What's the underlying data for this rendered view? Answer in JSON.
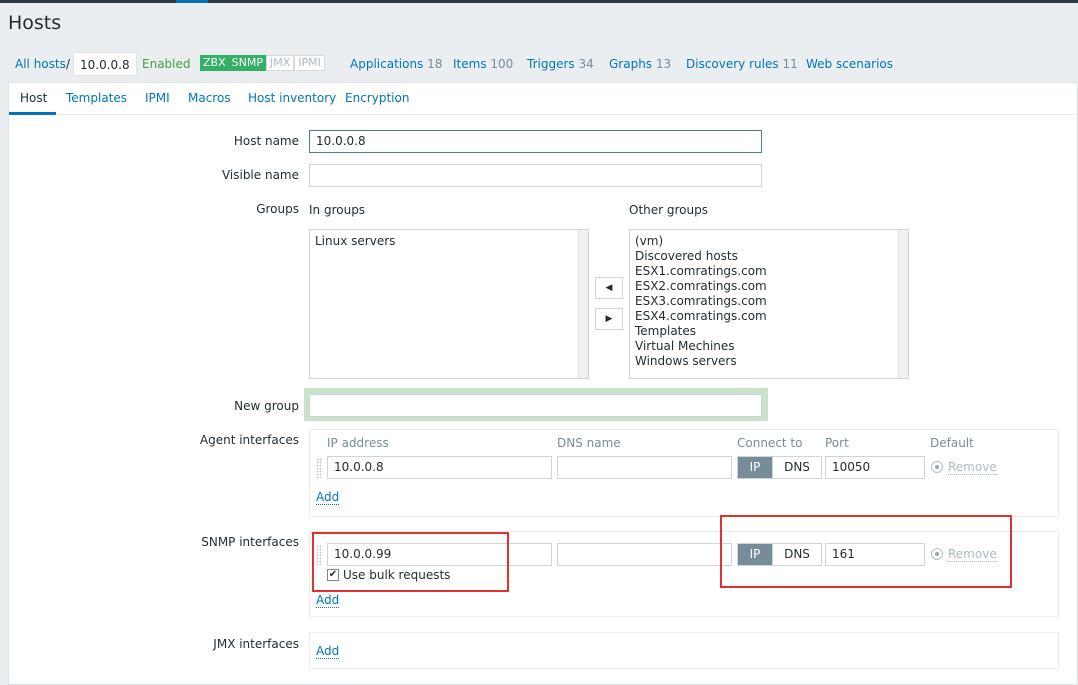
{
  "page": {
    "title": "Hosts"
  },
  "breadcrumb": {
    "all_hosts": "All hosts",
    "separator": "/",
    "current": "10.0.0.8",
    "status": "Enabled",
    "availability": [
      "ZBX",
      "SNMP",
      "JMX",
      "IPMI"
    ],
    "links": [
      {
        "label": "Applications",
        "count": "18"
      },
      {
        "label": "Items",
        "count": "100"
      },
      {
        "label": "Triggers",
        "count": "34"
      },
      {
        "label": "Graphs",
        "count": "13"
      },
      {
        "label": "Discovery rules",
        "count": "11"
      },
      {
        "label": "Web scenarios",
        "count": ""
      }
    ]
  },
  "tabs": [
    "Host",
    "Templates",
    "IPMI",
    "Macros",
    "Host inventory",
    "Encryption"
  ],
  "form": {
    "host_name_label": "Host name",
    "host_name_value": "10.0.0.8",
    "visible_name_label": "Visible name",
    "visible_name_value": "",
    "groups_label": "Groups",
    "in_groups_label": "In groups",
    "in_groups": [
      "Linux servers"
    ],
    "other_groups_label": "Other groups",
    "other_groups": [
      "(vm)",
      "Discovered hosts",
      "ESX1.comratings.com",
      "ESX2.comratings.com",
      "ESX3.comratings.com",
      "ESX4.comratings.com",
      "Templates",
      "Virtual Mechines",
      "Windows servers"
    ],
    "move_left": "◀",
    "move_right": "▶",
    "new_group_label": "New group",
    "new_group_value": ""
  },
  "interfaces": {
    "agent_label": "Agent interfaces",
    "snmp_label": "SNMP interfaces",
    "jmx_label": "JMX interfaces",
    "headers": {
      "ip": "IP address",
      "dns": "DNS name",
      "connect": "Connect to",
      "port": "Port",
      "default": "Default"
    },
    "agent": {
      "ip": "10.0.0.8",
      "dns": "",
      "port": "10050"
    },
    "snmp": {
      "ip": "10.0.0.99",
      "dns": "",
      "port": "161",
      "bulk_label": "Use bulk requests"
    },
    "ip_btn": "IP",
    "dns_btn": "DNS",
    "remove": "Remove",
    "add": "Add",
    "check_mark": "✔"
  },
  "colors": {
    "link": "#0275b8",
    "enabled": "#429e47",
    "annotation": "#e2312e"
  }
}
